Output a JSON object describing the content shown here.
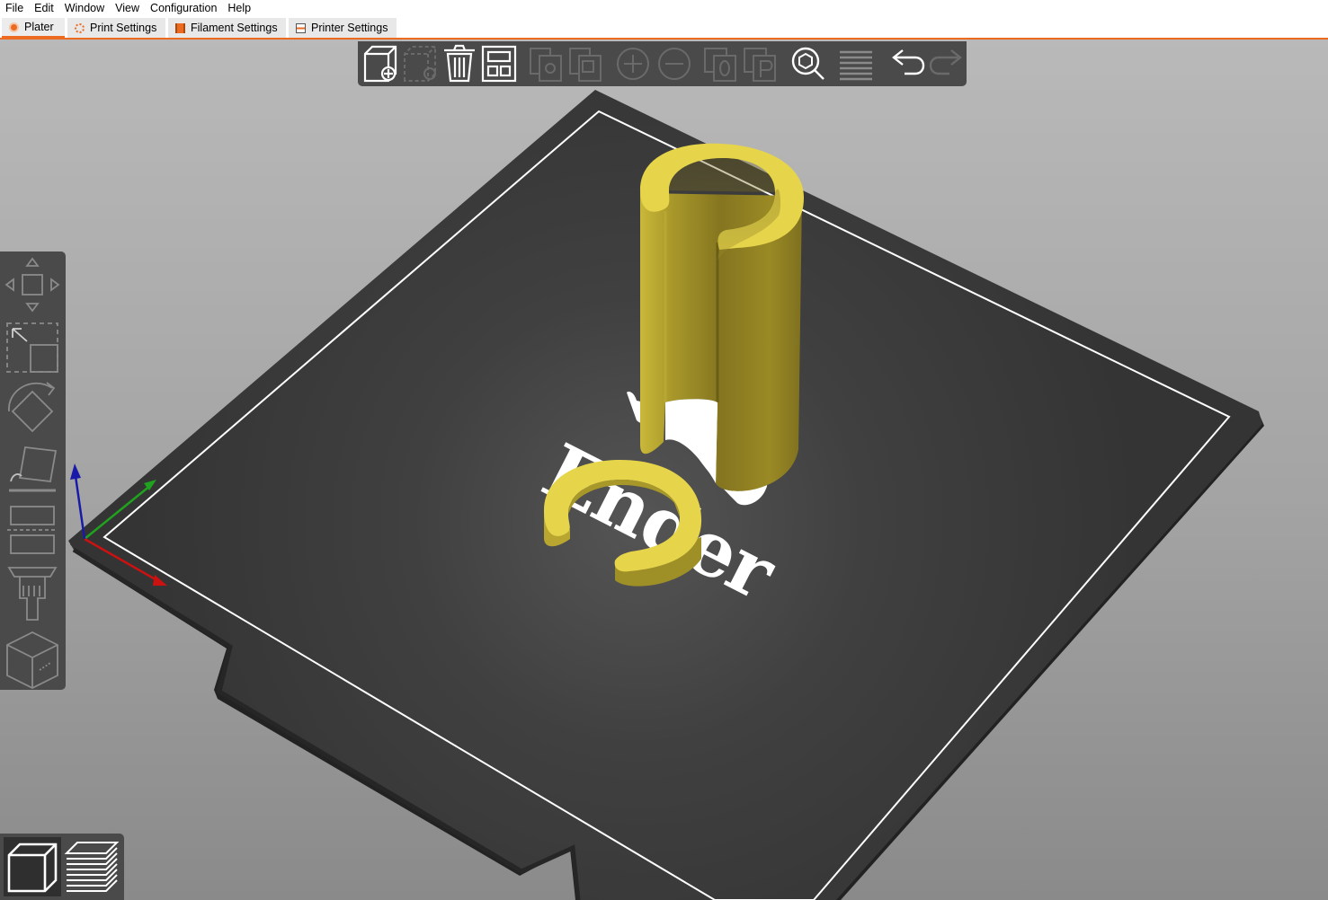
{
  "menu": [
    "File",
    "Edit",
    "Window",
    "View",
    "Configuration",
    "Help"
  ],
  "tabs": [
    {
      "label": "Plater",
      "icon": "plater-icon",
      "active": true
    },
    {
      "label": "Print Settings",
      "icon": "print-settings-icon",
      "active": false
    },
    {
      "label": "Filament Settings",
      "icon": "filament-spool-icon",
      "active": false
    },
    {
      "label": "Printer Settings",
      "icon": "printer-icon",
      "active": false
    }
  ],
  "top_toolbar": [
    {
      "name": "add-button",
      "icon": "add-object-icon",
      "enabled": true
    },
    {
      "name": "delete-button",
      "icon": "remove-object-icon",
      "enabled": false
    },
    {
      "name": "delete-all-button",
      "icon": "trash-icon",
      "enabled": true
    },
    {
      "name": "arrange-button",
      "icon": "arrange-icon",
      "enabled": true
    },
    {
      "name": "copy-button",
      "icon": "copy-icon",
      "enabled": false
    },
    {
      "name": "paste-button",
      "icon": "paste-icon",
      "enabled": false
    },
    {
      "name": "add-instance-button",
      "icon": "plus-circle-icon",
      "enabled": false
    },
    {
      "name": "remove-instance-button",
      "icon": "minus-circle-icon",
      "enabled": false
    },
    {
      "name": "split-to-objects-button",
      "icon": "split-objects-icon",
      "enabled": false
    },
    {
      "name": "split-to-parts-button",
      "icon": "split-parts-icon",
      "enabled": false
    },
    {
      "name": "search-button",
      "icon": "search-icon",
      "enabled": true
    },
    {
      "name": "layers-editing-button",
      "icon": "layers-icon",
      "enabled": true
    },
    {
      "name": "undo-button",
      "icon": "undo-icon",
      "enabled": true
    },
    {
      "name": "redo-button",
      "icon": "redo-icon",
      "enabled": false
    }
  ],
  "left_toolbar": [
    {
      "name": "move-tool-button",
      "icon": "move-icon"
    },
    {
      "name": "scale-tool-button",
      "icon": "scale-icon"
    },
    {
      "name": "rotate-tool-button",
      "icon": "rotate-icon"
    },
    {
      "name": "place-on-face-button",
      "icon": "place-on-face-icon"
    },
    {
      "name": "cut-tool-button",
      "icon": "cut-icon"
    },
    {
      "name": "paint-supports-button",
      "icon": "paint-brush-icon"
    },
    {
      "name": "variable-layer-button",
      "icon": "cube-icon"
    }
  ],
  "view_toolbar": [
    {
      "name": "3d-view-button",
      "icon": "cube-view-icon",
      "active": true
    },
    {
      "name": "preview-button",
      "icon": "layers-preview-icon",
      "active": false
    }
  ],
  "bed_logo_text": "Ender",
  "colors": {
    "accent": "#ED6B21",
    "object": "#E6D44B",
    "bed": "#3b3b3b",
    "toolbar": "#4a4a4a",
    "axis_x": "#cc1111",
    "axis_y": "#1fa31f",
    "axis_z": "#1a1aa8"
  }
}
